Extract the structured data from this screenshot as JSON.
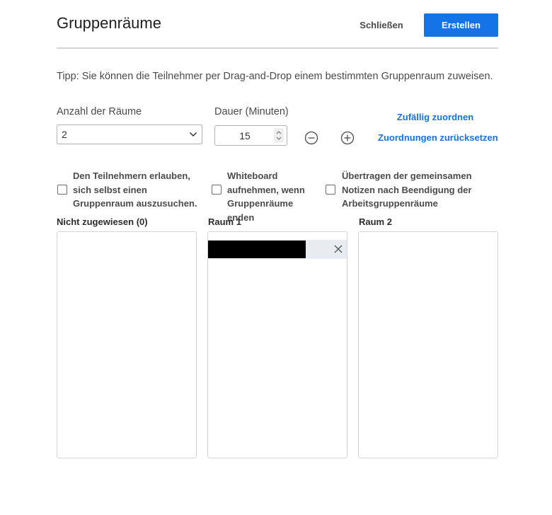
{
  "header": {
    "title": "Gruppenräume",
    "close_label": "Schließen",
    "create_label": "Erstellen"
  },
  "tip": "Tipp: Sie können die Teilnehmer per Drag-and-Drop einem bestimmten Gruppenraum zuweisen.",
  "rooms": {
    "label": "Anzahl der Räume",
    "value": "2"
  },
  "duration": {
    "label": "Dauer (Minuten)",
    "value": "15"
  },
  "actions": {
    "random_assign": "Zufällig zuordnen",
    "reset_assignments": "Zuordnungen zurücksetzen"
  },
  "options": [
    {
      "label": "Den Teilnehmern erlauben, sich selbst einen Gruppenraum auszusuchen.",
      "checked": false
    },
    {
      "label": "Whiteboard aufnehmen, wenn Gruppenräume enden",
      "checked": false
    },
    {
      "label": "Übertragen der gemeinsamen Notizen nach Beendigung der Arbeitsgruppenräume",
      "checked": false
    }
  ],
  "columns": [
    {
      "title": "Nicht zugewiesen (0)"
    },
    {
      "title": "Raum 1"
    },
    {
      "title": "Raum 2"
    }
  ],
  "colors": {
    "accent": "#1473e6",
    "participant_row": "#e8ebef"
  }
}
